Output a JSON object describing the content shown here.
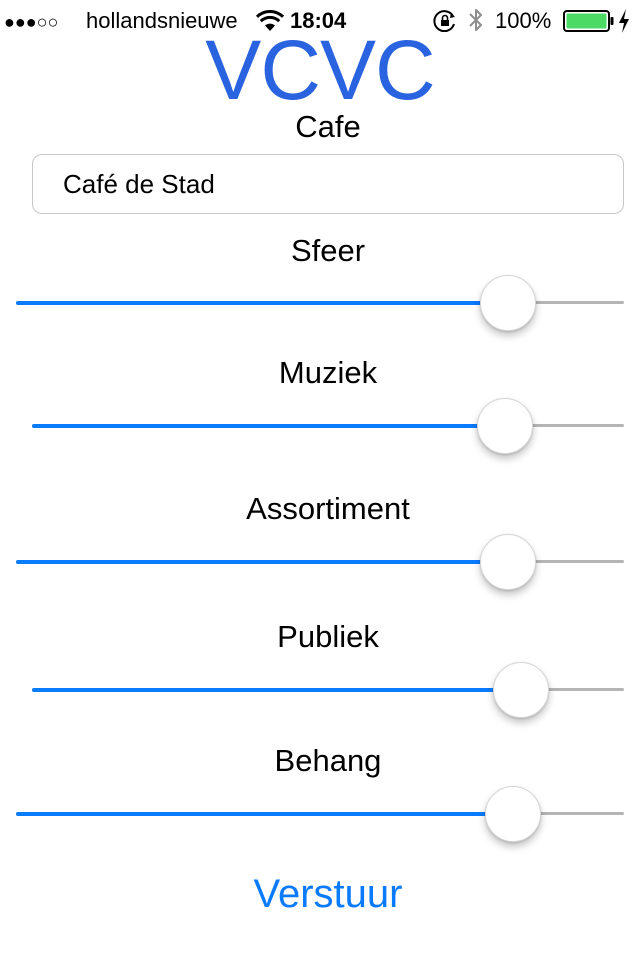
{
  "status_bar": {
    "signal_dots": "●●●○○",
    "carrier": "hollandsnieuwe",
    "time": "18:04",
    "battery_percent": "100%",
    "battery_level": 1.0,
    "battery_color": "#4cd964",
    "icons": [
      "wifi-icon",
      "rotation-lock-icon",
      "bluetooth-icon",
      "battery-icon",
      "charging-icon"
    ]
  },
  "app": {
    "title": "VCVC",
    "title_color": "#2a63e0",
    "accent_color": "#0a7aff"
  },
  "cafe": {
    "label": "Cafe",
    "value": "Café de Stad"
  },
  "ratings": [
    {
      "label": "Sfeer",
      "value": 0.84
    },
    {
      "label": "Muziek",
      "value": 0.83
    },
    {
      "label": "Assortiment",
      "value": 0.84
    },
    {
      "label": "Publiek",
      "value": 0.86
    },
    {
      "label": "Behang",
      "value": 0.85
    }
  ],
  "submit_label": "Verstuur"
}
